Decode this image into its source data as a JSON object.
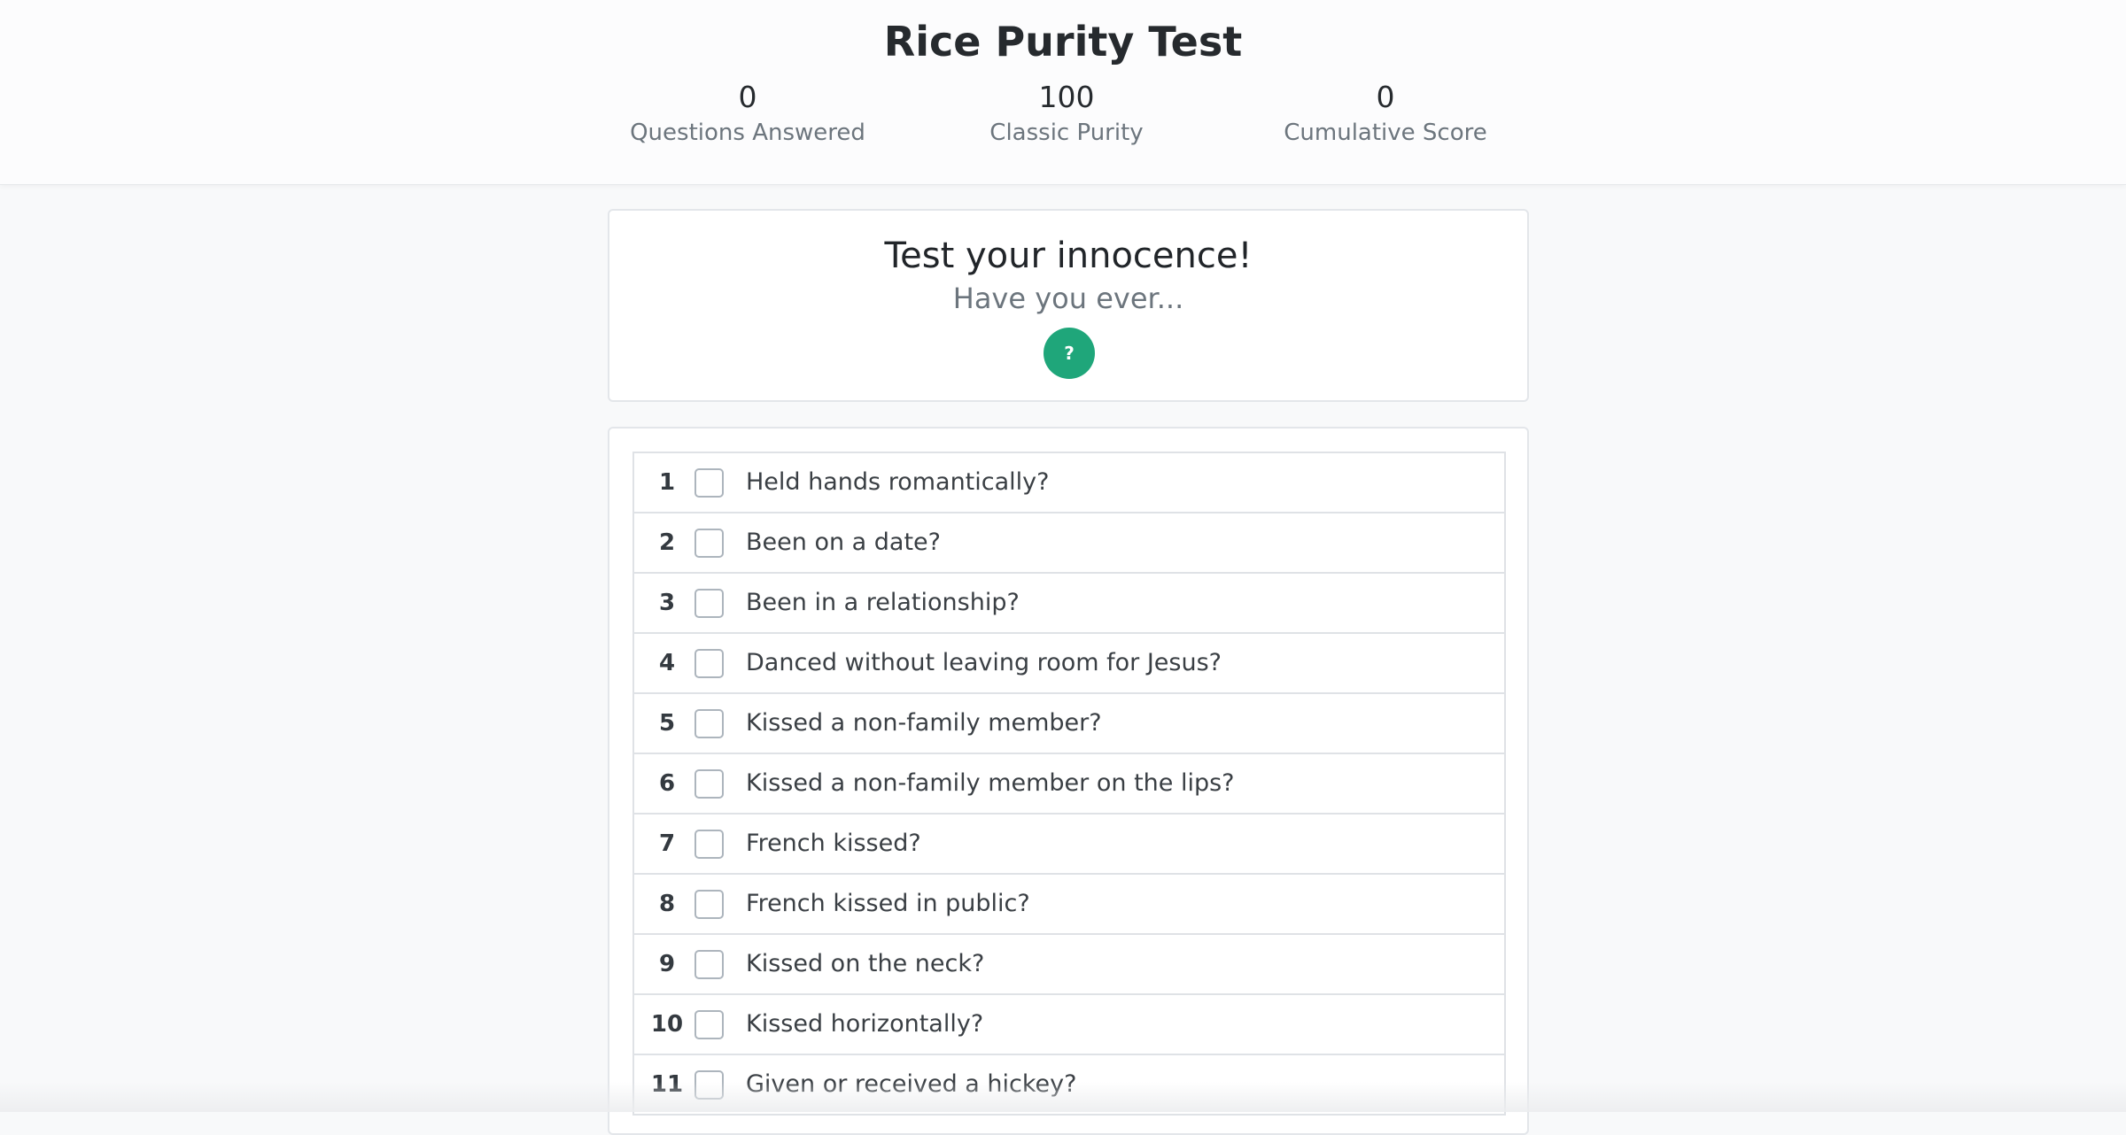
{
  "header": {
    "title": "Rice Purity Test",
    "stats": {
      "answered": {
        "value": "0",
        "label": "Questions Answered"
      },
      "purity": {
        "value": "100",
        "label": "Classic Purity"
      },
      "score": {
        "value": "0",
        "label": "Cumulative Score"
      }
    }
  },
  "intro": {
    "title": "Test your innocence!",
    "subtitle": "Have you ever...",
    "help_label": "?"
  },
  "questions": [
    {
      "num": "1",
      "text": "Held hands romantically?",
      "checked": false
    },
    {
      "num": "2",
      "text": "Been on a date?",
      "checked": false
    },
    {
      "num": "3",
      "text": "Been in a relationship?",
      "checked": false
    },
    {
      "num": "4",
      "text": "Danced without leaving room for Jesus?",
      "checked": false
    },
    {
      "num": "5",
      "text": "Kissed a non-family member?",
      "checked": false
    },
    {
      "num": "6",
      "text": "Kissed a non-family member on the lips?",
      "checked": false
    },
    {
      "num": "7",
      "text": "French kissed?",
      "checked": false
    },
    {
      "num": "8",
      "text": "French kissed in public?",
      "checked": false
    },
    {
      "num": "9",
      "text": "Kissed on the neck?",
      "checked": false
    },
    {
      "num": "10",
      "text": "Kissed horizontally?",
      "checked": false
    },
    {
      "num": "11",
      "text": "Given or received a hickey?",
      "checked": false
    }
  ],
  "colors": {
    "accent": "#1fa67a",
    "background": "#f8f9fa",
    "muted_text": "#6c757d"
  }
}
